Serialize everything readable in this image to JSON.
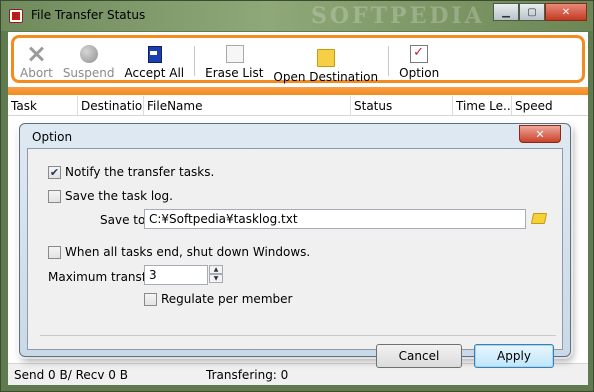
{
  "window": {
    "title": "File Transfer Status",
    "watermark": "SOFTPEDIA"
  },
  "toolbar": {
    "buttons": [
      {
        "label": "Abort",
        "icon": "abort-icon",
        "enabled": false
      },
      {
        "label": "Suspend",
        "icon": "suspend-icon",
        "enabled": false
      },
      {
        "label": "Accept All",
        "icon": "accept-all-icon",
        "enabled": true
      },
      {
        "label": "Erase List",
        "icon": "erase-list-icon",
        "enabled": true
      },
      {
        "label": "Open Destination",
        "icon": "folder-icon",
        "enabled": true
      },
      {
        "label": "Option",
        "icon": "option-icon",
        "enabled": true
      }
    ]
  },
  "columns": [
    "Task",
    "Destination",
    "FileName",
    "Status",
    "Time Le...",
    "Speed"
  ],
  "status": {
    "traffic": "Send 0 B/ Recv 0 B",
    "transfering": "Transfering: 0"
  },
  "dialog": {
    "title": "Option",
    "notify_label": "Notify the transfer tasks.",
    "notify_checked": true,
    "save_log_label": "Save the task log.",
    "save_log_checked": false,
    "save_to_label": "Save to:",
    "save_to_value": "C:¥Softpedia¥tasklog.txt",
    "shutdown_label": "When all tasks end, shut down Windows.",
    "shutdown_checked": false,
    "max_transfer_label": "Maximum transfer:",
    "max_transfer_value": "3",
    "regulate_label": "Regulate per member",
    "regulate_checked": false,
    "cancel_label": "Cancel",
    "apply_label": "Apply"
  },
  "colors": {
    "accent": "#f58a1d"
  }
}
